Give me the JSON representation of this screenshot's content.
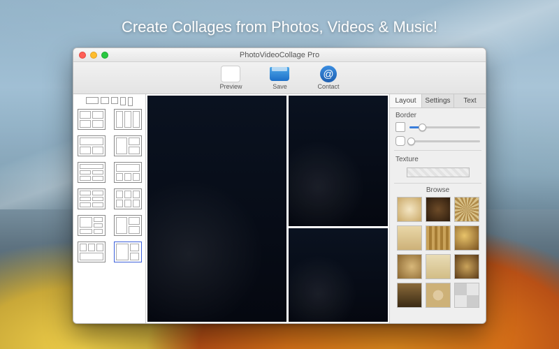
{
  "promo": {
    "tagline": "Create Collages from Photos, Videos & Music!"
  },
  "window": {
    "title": "PhotoVideoCollage Pro"
  },
  "toolbar": {
    "preview_label": "Preview",
    "save_label": "Save",
    "contact_label": "Contact"
  },
  "templates": {
    "aspect_options": [
      "16:9",
      "4:3",
      "1:1",
      "3:4",
      "9:16"
    ],
    "selected_index": 11,
    "items": [
      {
        "rows": 2,
        "cols": 2,
        "cells": [
          [
            0,
            0
          ],
          [
            0,
            1
          ],
          [
            1,
            0
          ],
          [
            1,
            1
          ]
        ]
      },
      {
        "rows": 1,
        "cols": 3
      },
      {
        "rows": 2,
        "cols": 2,
        "span": "top"
      },
      {
        "rows": 2,
        "cols": 2,
        "span": "left"
      },
      {
        "rows": 3,
        "cols": 2,
        "header": true
      },
      {
        "rows": 2,
        "cols": 3,
        "header": true
      },
      {
        "rows": 3,
        "cols": 2
      },
      {
        "rows": 2,
        "cols": 3
      },
      {
        "rows": 3,
        "cols": 2,
        "asym": true
      },
      {
        "rows": 2,
        "cols": 2,
        "offset": true
      },
      {
        "rows": 2,
        "cols": 3,
        "header": true
      },
      {
        "rows": 2,
        "cols": 2,
        "bigleft": true
      }
    ]
  },
  "canvas": {
    "layout": "big-left-2x2",
    "cells": [
      {
        "slot": "main",
        "subject": "empire-state-night"
      },
      {
        "slot": "top-right",
        "subject": "chrysler-night"
      },
      {
        "slot": "mid-right",
        "subject": "midtown-skyline-night"
      },
      {
        "slot": "bottom-right",
        "subject": "downtown-skyline-night"
      }
    ]
  },
  "sidebar": {
    "tabs": [
      "Layout",
      "Settings",
      "Text"
    ],
    "active_tab": 0,
    "border": {
      "label": "Border",
      "width_value": 0.18,
      "corner_value": 0.02
    },
    "texture": {
      "label": "Texture",
      "browse_label": "Browse",
      "swatches": [
        {
          "name": "parchment-center",
          "bg": "radial-gradient(circle,#f4e6c4,#c9a867)"
        },
        {
          "name": "vignette-brown",
          "bg": "radial-gradient(circle,#6d4b28,#2e1d0e)"
        },
        {
          "name": "sunburst",
          "bg": "repeating-conic-gradient(#d9c28a 0 10deg,#b08b4a 10deg 20deg)"
        },
        {
          "name": "paper-tan",
          "bg": "linear-gradient(#e9d7a8,#cdb178)"
        },
        {
          "name": "wood-stripes",
          "bg": "repeating-linear-gradient(90deg,#caa35a 0 4px,#a67c34 4px 8px)"
        },
        {
          "name": "grunge-gold",
          "bg": "radial-gradient(circle at 40% 40%,#e8c36a,#7a5220)"
        },
        {
          "name": "stained",
          "bg": "radial-gradient(circle at 60% 50%,#d8b87a,#8a6630)"
        },
        {
          "name": "aged-paper",
          "bg": "linear-gradient(#e9dcb6,#d2bd86)"
        },
        {
          "name": "burnt",
          "bg": "radial-gradient(circle,#caa35a,#5a3a18)"
        },
        {
          "name": "film-sepia",
          "bg": "linear-gradient(#8a6a3a,#3a2a14)"
        },
        {
          "name": "canvas-dots",
          "bg": "radial-gradient(circle,#e0caa0 30%,#cdb178 31%)"
        },
        {
          "name": "checker",
          "bg": "repeating-conic-gradient(#e6e6e6 0 25%,#cccccc 0 50%)"
        }
      ]
    }
  }
}
